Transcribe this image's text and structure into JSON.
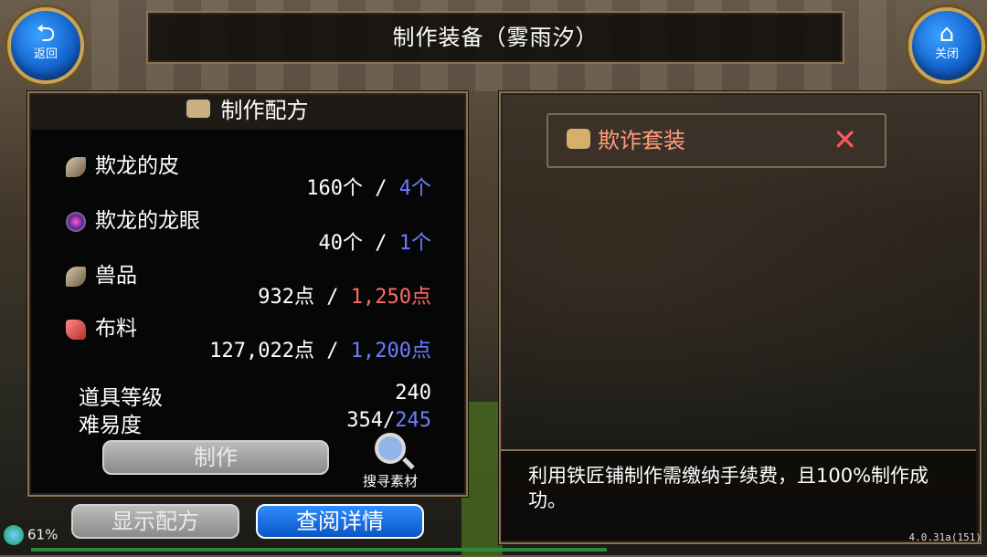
{
  "title_bar": {
    "title": "制作装备（雾雨汐）"
  },
  "back_button": {
    "label": "返回",
    "icon": "back-arrow-icon"
  },
  "close_button": {
    "label": "关闭",
    "icon": "home-icon"
  },
  "recipe_panel": {
    "header": "制作配方",
    "materials": [
      {
        "name": "欺龙的皮",
        "have": "160个",
        "sep": " / ",
        "need": "4个",
        "need_color": "#6d7dff"
      },
      {
        "name": "欺龙的龙眼",
        "have": "40个",
        "sep": " / ",
        "need": "1个",
        "need_color": "#6d7dff"
      },
      {
        "name": "兽品",
        "have": "932点",
        "sep": " / ",
        "need": "1,250点",
        "need_color": "#ff6b6b"
      },
      {
        "name": "布料",
        "have": "127,022点",
        "sep": " / ",
        "need": "1,200点",
        "need_color": "#6d7dff"
      }
    ],
    "item_level_label": "道具等级",
    "item_level_value": "240",
    "difficulty_label": "难易度",
    "difficulty_value_a": "354/",
    "difficulty_value_b": "245",
    "craft_button": "制作",
    "search_materials": "搜寻素材",
    "show_recipe_button": "显示配方",
    "view_details_button": "查阅详情"
  },
  "detail_panel": {
    "set_name": "欺诈套装",
    "close_symbol": "✕",
    "description": "利用铁匠铺制作需缴纳手续费，且100%制作成功。"
  },
  "status": {
    "battery": "61%",
    "version": "4.0.31a(151)"
  }
}
